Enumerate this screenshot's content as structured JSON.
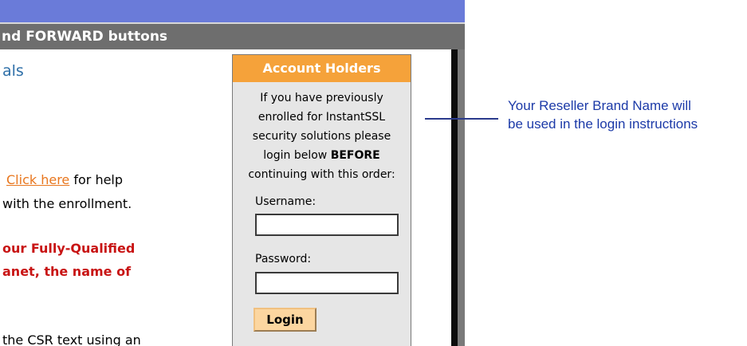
{
  "header": {
    "title": "nd FORWARD buttons"
  },
  "page": {
    "subtitle": "als",
    "help_link": "Click here",
    "help_text_after_link": " for help",
    "help_line2": "with the enrollment.",
    "red_line1": "our Fully-Qualified",
    "red_line2": "anet, the name of",
    "csr_line": "the CSR text using an"
  },
  "account_box": {
    "header": "Account Holders",
    "text_line1": "If you have previously",
    "text_line2": "enrolled for InstantSSL",
    "text_line3": "security solutions please",
    "text_line4_prefix": "login below ",
    "text_line4_bold": "BEFORE",
    "text_line5": "continuing with this order:",
    "username_label": "Username:",
    "username_value": "",
    "password_label": "Password:",
    "password_value": "",
    "login_label": "Login"
  },
  "callout": {
    "line1": "Your Reseller Brand Name will",
    "line2": "be used in the login instructions"
  },
  "colors": {
    "top_bar": "#6a7bd9",
    "title_bar": "#6e6e6e",
    "account_header": "#f5a23a",
    "link": "#e8761d",
    "red_text": "#c81414",
    "callout_text": "#1c3aa8"
  }
}
